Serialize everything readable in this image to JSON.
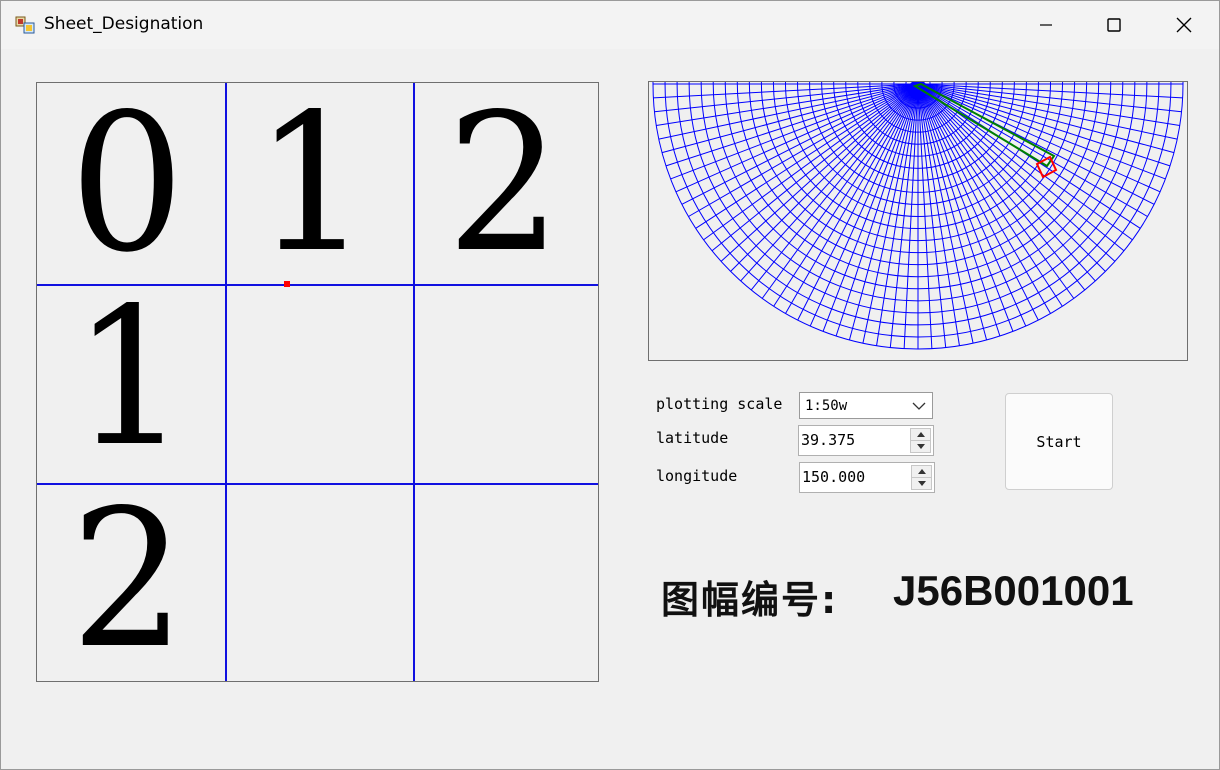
{
  "window": {
    "title": "Sheet_Designation"
  },
  "grid": {
    "column_labels": [
      "0",
      "1",
      "2"
    ],
    "row_labels": [
      "1",
      "2"
    ],
    "line_color": "#1010e0",
    "marker_color": "#ff0000"
  },
  "projection": {
    "grid_color": "#0000ff",
    "highlight_strip_color": "#008000",
    "highlight_cell_color": "#ff0000"
  },
  "controls": {
    "scale_label": "plotting scale",
    "scale_value": "1:50w",
    "latitude_label": "latitude",
    "latitude_value": "39.375",
    "longitude_label": "longitude",
    "longitude_value": "150.000",
    "start_label": "Start"
  },
  "result": {
    "label": "图幅编号:",
    "value": "J56B001001"
  }
}
